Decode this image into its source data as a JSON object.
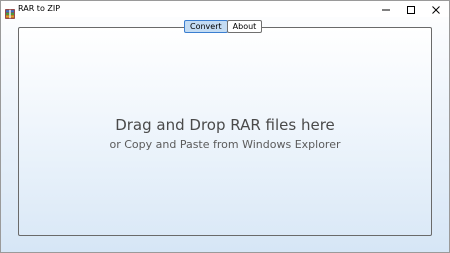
{
  "window": {
    "title": "RAR to ZIP",
    "icon": "rar-archive-icon"
  },
  "titlebar_buttons": {
    "minimize_icon": "minimize-icon",
    "maximize_icon": "maximize-icon",
    "close_icon": "close-icon"
  },
  "tabs": [
    {
      "label": "Convert",
      "active": true
    },
    {
      "label": "About",
      "active": false
    }
  ],
  "dropzone": {
    "headline": "Drag and Drop RAR files here",
    "subtext": "or Copy and Paste from Windows Explorer"
  },
  "colors": {
    "active_tab_bg": "#c4dcf3",
    "active_tab_border": "#3b7ed0",
    "gradient_bottom": "#d6e6f6"
  }
}
